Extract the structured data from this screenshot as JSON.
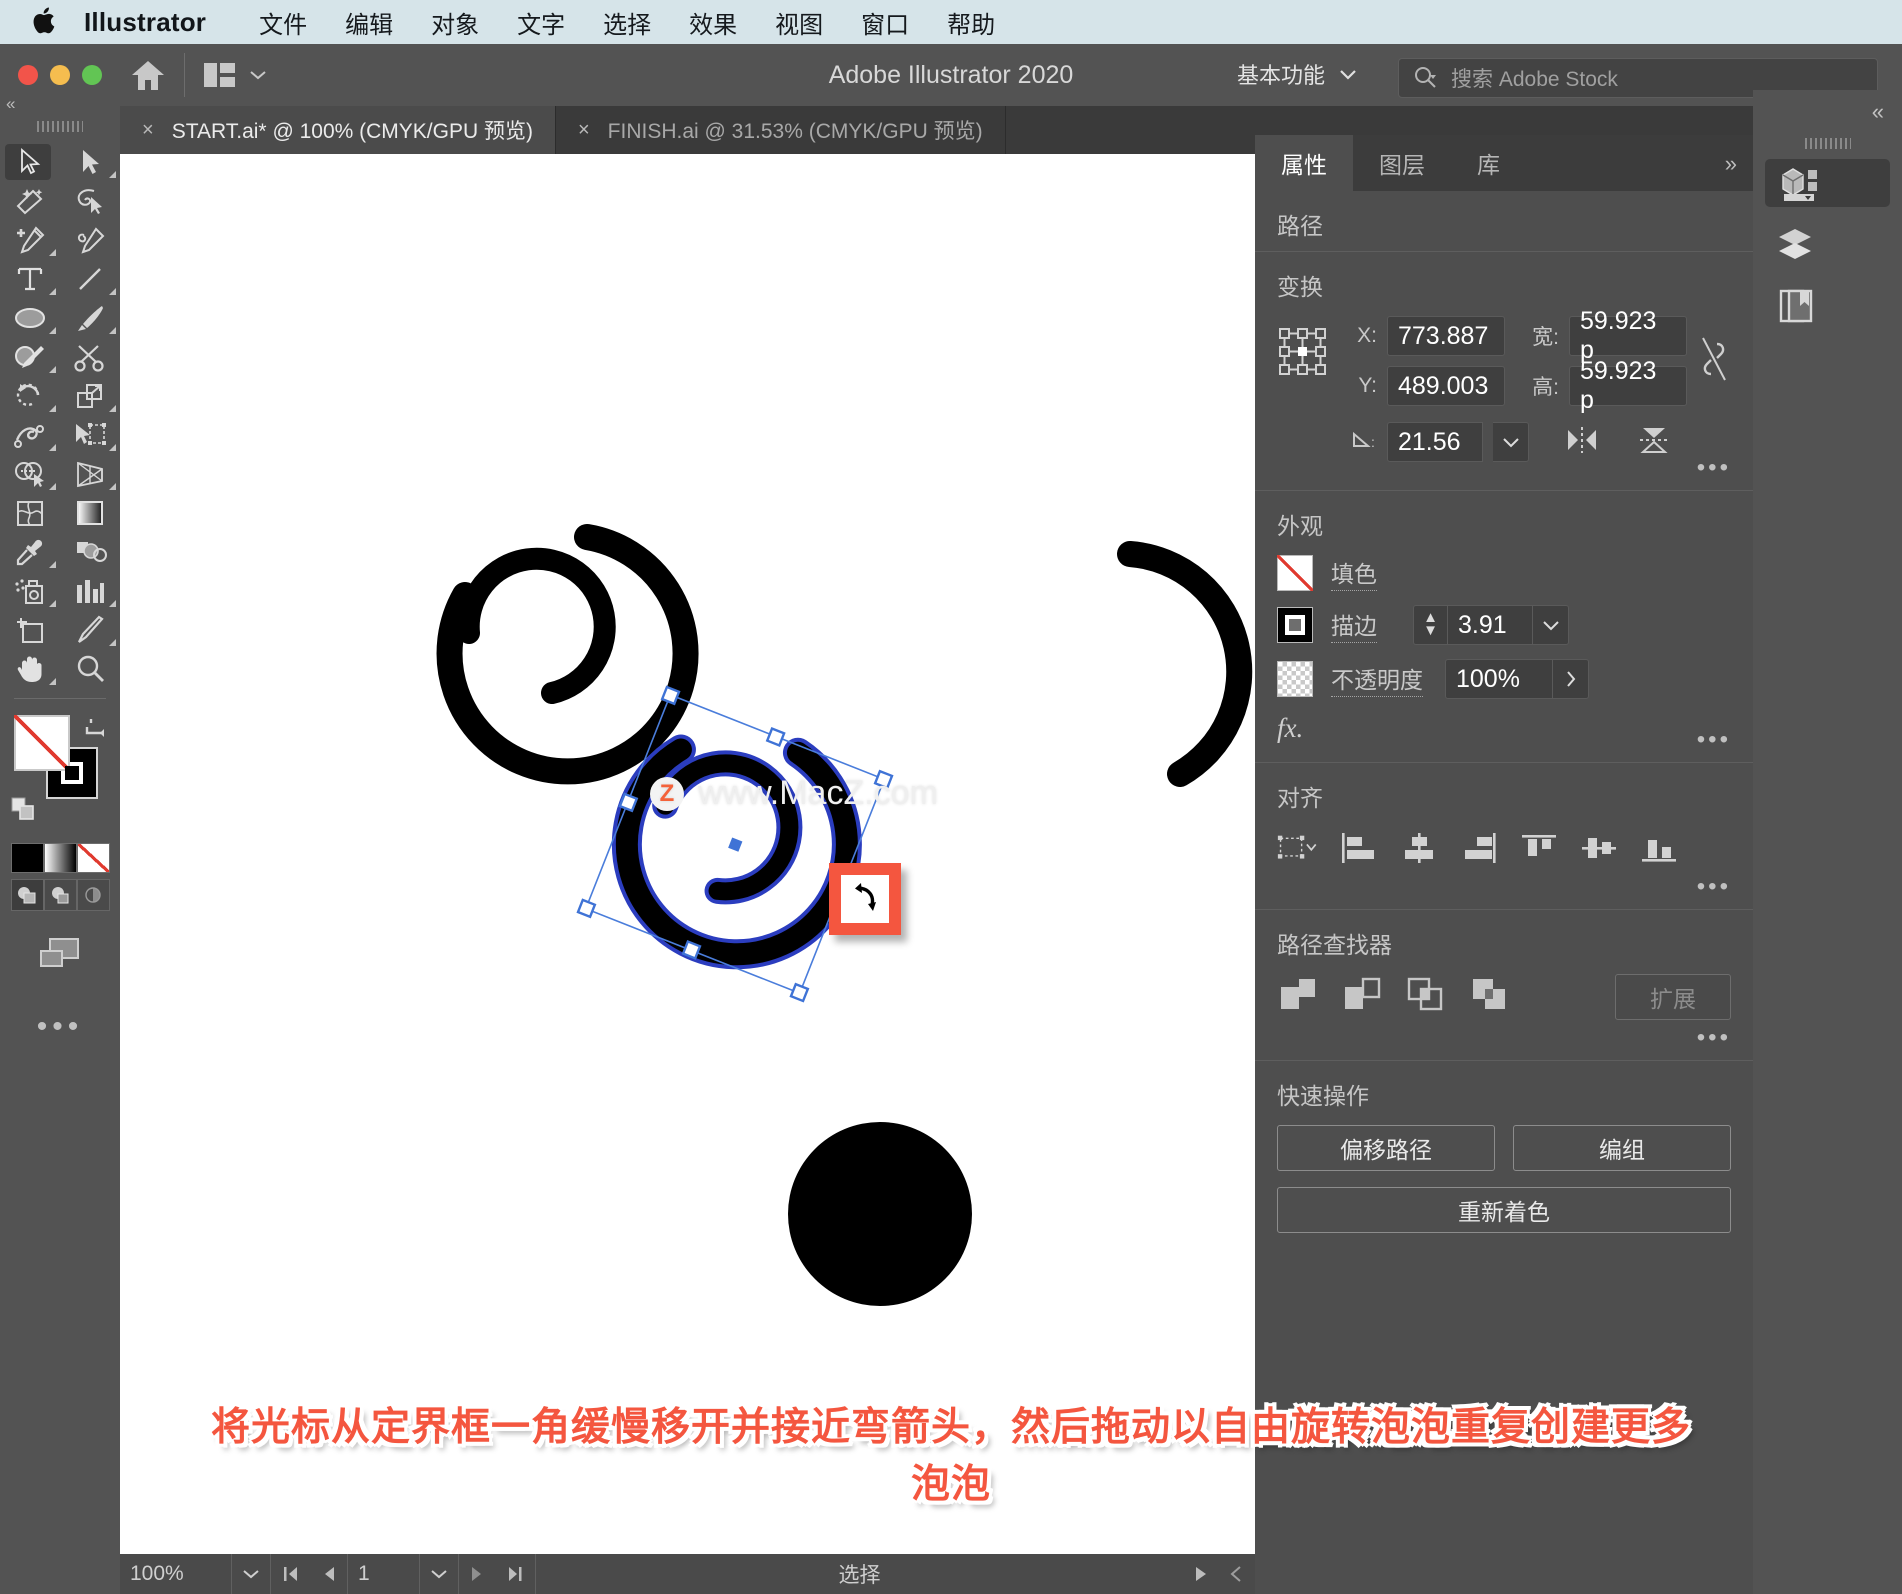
{
  "menubar": {
    "apple_icon": "apple-logo",
    "app_name": "Illustrator",
    "items": [
      "文件",
      "编辑",
      "对象",
      "文字",
      "选择",
      "效果",
      "视图",
      "窗口",
      "帮助"
    ]
  },
  "titlebar": {
    "doc_title": "Adobe Illustrator 2020",
    "home_icon": "home-icon",
    "arrange_icon": "arrange-documents-icon",
    "workspace": "基本功能",
    "workspace_chevron": "chevron-down-icon",
    "search_icon": "search-icon",
    "search_placeholder": "搜索 Adobe Stock",
    "search_value": ""
  },
  "tabs": [
    {
      "close": "×",
      "label": "START.ai* @ 100% (CMYK/GPU 预览)",
      "active": true
    },
    {
      "close": "×",
      "label": "FINISH.ai @ 31.53% (CMYK/GPU 预览)",
      "active": false
    }
  ],
  "toolbar": {
    "collapse_icon": "collapse-panel-icon",
    "tools": [
      {
        "name": "selection-tool",
        "sel": true,
        "corner": false
      },
      {
        "name": "direct-selection-tool",
        "sel": false,
        "corner": true
      },
      {
        "name": "magic-wand-tool",
        "sel": false,
        "corner": false
      },
      {
        "name": "lasso-tool",
        "sel": false,
        "corner": false
      },
      {
        "name": "pen-tool",
        "sel": false,
        "corner": true
      },
      {
        "name": "curvature-tool",
        "sel": false,
        "corner": false
      },
      {
        "name": "type-tool",
        "sel": false,
        "corner": true
      },
      {
        "name": "line-segment-tool",
        "sel": false,
        "corner": true
      },
      {
        "name": "ellipse-tool",
        "sel": false,
        "corner": true
      },
      {
        "name": "paintbrush-tool",
        "sel": false,
        "corner": true
      },
      {
        "name": "shaper-tool",
        "sel": false,
        "corner": true
      },
      {
        "name": "scissors-tool",
        "sel": false,
        "corner": false
      },
      {
        "name": "rotate-tool",
        "sel": false,
        "corner": true
      },
      {
        "name": "scale-tool",
        "sel": false,
        "corner": true
      },
      {
        "name": "width-tool",
        "sel": false,
        "corner": true
      },
      {
        "name": "free-transform-tool",
        "sel": false,
        "corner": true
      },
      {
        "name": "shape-builder-tool",
        "sel": false,
        "corner": true
      },
      {
        "name": "perspective-grid-tool",
        "sel": false,
        "corner": true
      },
      {
        "name": "mesh-tool",
        "sel": false,
        "corner": false
      },
      {
        "name": "gradient-tool",
        "sel": false,
        "corner": false
      },
      {
        "name": "eyedropper-tool",
        "sel": false,
        "corner": true
      },
      {
        "name": "blend-tool",
        "sel": false,
        "corner": false
      },
      {
        "name": "symbol-sprayer-tool",
        "sel": false,
        "corner": true
      },
      {
        "name": "column-graph-tool",
        "sel": false,
        "corner": true
      },
      {
        "name": "artboard-tool",
        "sel": false,
        "corner": false
      },
      {
        "name": "slice-tool",
        "sel": false,
        "corner": true
      },
      {
        "name": "hand-tool",
        "sel": false,
        "corner": true
      },
      {
        "name": "zoom-tool",
        "sel": false,
        "corner": false
      }
    ],
    "fill_swatch": "none-fill-swatch",
    "stroke_swatch": "black-stroke-swatch",
    "swap_icon": "swap-fill-stroke-icon",
    "default_icon": "default-fill-stroke-icon",
    "color_modes": [
      "color-swatch",
      "gradient-swatch",
      "none-swatch"
    ],
    "draw_modes": [
      "draw-normal",
      "draw-behind",
      "draw-inside"
    ],
    "screen_mode_icon": "change-screen-mode-icon",
    "more_icon": "edit-toolbar-icon"
  },
  "canvas": {
    "watermark_badge": "Z",
    "watermark_text": "www.MacZ.com",
    "selection": {
      "bbox_rotation_deg": 21.56,
      "rotate_cursor_icon": "rotate-cursor",
      "highlight_color": "#f4563f"
    }
  },
  "statusbar": {
    "zoom": "100%",
    "zoom_chevron": "chevron-down-icon",
    "first_icon": "first-artboard-icon",
    "prev_icon": "prev-artboard-icon",
    "artboard": "1",
    "artboard_chevron": "chevron-down-icon",
    "next_icon": "next-artboard-icon",
    "last_icon": "last-artboard-icon",
    "status_text": "选择",
    "play_icon": "play-icon",
    "back_icon": "back-icon"
  },
  "properties": {
    "tabs": [
      {
        "label": "属性",
        "active": true
      },
      {
        "label": "图层",
        "active": false
      },
      {
        "label": "库",
        "active": false
      }
    ],
    "more_icon": "»",
    "object_type_label": "路径",
    "transform": {
      "title": "变换",
      "reference_point_icon": "reference-point-grid",
      "x_label": "X:",
      "x_value": "773.887",
      "y_label": "Y:",
      "y_value": "489.003",
      "w_label": "宽:",
      "w_value": "59.923 p",
      "h_label": "高:",
      "h_value": "59.923 p",
      "link_icon": "unlink-proportions-icon",
      "angle_icon": "shear-angle-icon",
      "angle_label": "⊿:",
      "angle_value": "21.56",
      "flip_h_icon": "flip-horizontal-icon",
      "flip_v_icon": "flip-vertical-icon",
      "more": "•••"
    },
    "appearance": {
      "title": "外观",
      "fill_label": "填色",
      "fill_swatch": "none-fill-swatch",
      "stroke_label": "描边",
      "stroke_swatch": "black-stroke-swatch",
      "stroke_weight": "3.91",
      "stroke_stepper_icon": "stepper-up-down-icon",
      "stroke_chevron": "chevron-down-icon",
      "opacity_label": "不透明度",
      "opacity_swatch": "transparency-checker-swatch",
      "opacity_value": "100%",
      "opacity_arrow": "chevron-right-icon",
      "fx_label": "fx.",
      "more": "•••"
    },
    "align": {
      "title": "对齐",
      "target_icon": "align-to-selection-icon",
      "target_chevron": "chevron-down-icon",
      "buttons": [
        "align-left-icon",
        "align-horizontal-center-icon",
        "align-right-icon",
        "align-top-icon",
        "align-vertical-center-icon",
        "align-bottom-icon"
      ],
      "more": "•••"
    },
    "pathfinder": {
      "title": "路径查找器",
      "buttons": [
        "unite-icon",
        "minus-front-icon",
        "intersect-icon",
        "exclude-icon"
      ],
      "expand_label": "扩展",
      "more": "•••"
    },
    "quick_actions": {
      "title": "快速操作",
      "offset_path": "偏移路径",
      "group": "编组",
      "recolor": "重新着色"
    }
  },
  "right_dock": {
    "collapse_icon": "«",
    "items": [
      {
        "name": "properties-panel-icon",
        "active": true
      },
      {
        "name": "layers-panel-icon",
        "active": false
      },
      {
        "name": "libraries-panel-icon",
        "active": false
      }
    ]
  },
  "caption": {
    "line1": "将光标从定界框一角缓慢移开并接近弯箭头，然后拖动以自由旋转泡泡重复创建更多",
    "line2": "泡泡"
  }
}
